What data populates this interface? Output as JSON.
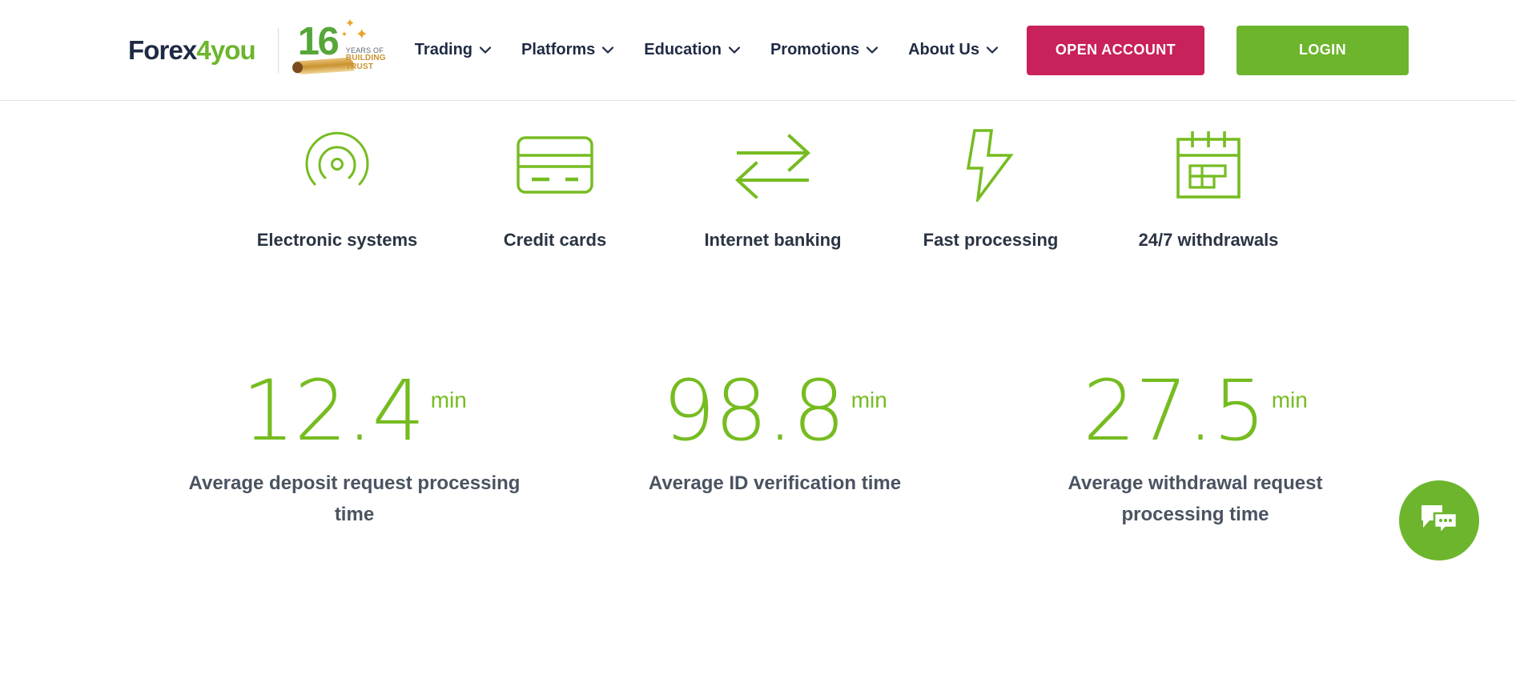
{
  "header": {
    "brand": {
      "text_dark": "Forex",
      "text_accent": "4you"
    },
    "anniversary": {
      "number": "16",
      "line1": "YEARS OF",
      "line2": "BUILDING",
      "line3": "TRUST"
    },
    "nav": [
      {
        "label": "Trading",
        "icon": "chevron-down-icon"
      },
      {
        "label": "Platforms",
        "icon": "chevron-down-icon"
      },
      {
        "label": "Education",
        "icon": "chevron-down-icon"
      },
      {
        "label": "Promotions",
        "icon": "chevron-down-icon"
      },
      {
        "label": "About Us",
        "icon": "chevron-down-icon"
      }
    ],
    "open_account_label": "OPEN ACCOUNT",
    "login_label": "LOGIN"
  },
  "features": [
    {
      "label": "Electronic systems",
      "icon": "radar-signal-icon"
    },
    {
      "label": "Credit cards",
      "icon": "credit-card-icon"
    },
    {
      "label": "Internet banking",
      "icon": "transfer-arrows-icon"
    },
    {
      "label": "Fast processing",
      "icon": "lightning-bolt-icon"
    },
    {
      "label": "24/7 withdrawals",
      "icon": "calendar-icon"
    }
  ],
  "stats": [
    {
      "number": "12.4",
      "unit": "min",
      "label": "Average deposit request processing time"
    },
    {
      "number": "98.8",
      "unit": "min",
      "label": "Average ID verification time"
    },
    {
      "number": "27.5",
      "unit": "min",
      "label": "Average withdrawal request processing time"
    }
  ],
  "chat": {
    "icon": "chat-bubbles-icon"
  },
  "colors": {
    "green": "#6cb52d",
    "green_stat": "#76bc21",
    "crimson": "#c9215b",
    "navy": "#1f2a44",
    "slate": "#4a5361",
    "gold": "#c9922f"
  }
}
